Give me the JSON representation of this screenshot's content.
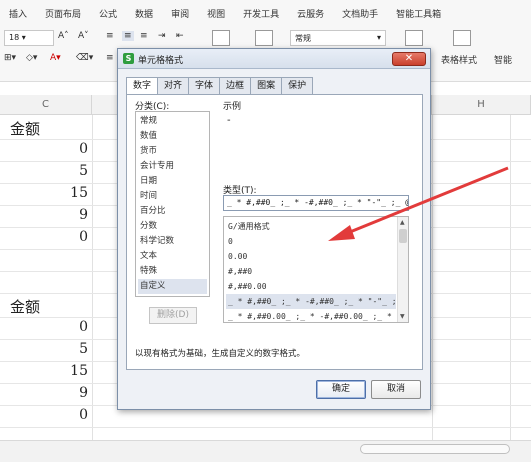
{
  "menubar": {
    "tabs": [
      "插入",
      "页面布局",
      "公式",
      "数据",
      "审阅",
      "视图",
      "开发工具",
      "云服务",
      "文档助手",
      "智能工具箱"
    ]
  },
  "ribbon": {
    "font_size": "18",
    "number_format": "常规",
    "table_style_label": "表格样式",
    "smart_label": "智能"
  },
  "sheet": {
    "col_c": "C",
    "col_h": "H",
    "header1": "金额",
    "header2": "金额",
    "values1": [
      "0",
      "5",
      "15",
      "9",
      "0"
    ],
    "values2": [
      "0",
      "5",
      "15",
      "9",
      "0"
    ]
  },
  "dialog": {
    "title": "单元格格式",
    "close_label": "✕",
    "tabs": [
      "数字",
      "对齐",
      "字体",
      "边框",
      "图案",
      "保护"
    ],
    "active_tab": "数字",
    "category_label": "分类(C):",
    "categories": [
      "常规",
      "数值",
      "货币",
      "会计专用",
      "日期",
      "时间",
      "百分比",
      "分数",
      "科学记数",
      "文本",
      "特殊",
      "自定义"
    ],
    "selected_category": "自定义",
    "sample_label": "示例",
    "sample_value": "-",
    "type_label": "类型(T):",
    "type_value": "_ * #,##0_ ;_ * -#,##0_ ;_ * \"-\"_ ;_ @_",
    "type_list": [
      "G/通用格式",
      "0",
      "0.00",
      "#,##0",
      "#,##0.00",
      "_ * #,##0_ ;_ * -#,##0_ ;_ * \"-\"_ ;_ @_",
      "_ * #,##0.00_ ;_ * -#,##0.00_ ;_ * \"-\"??_ ;_ @_"
    ],
    "selected_type_index": 5,
    "delete_button": "删除(D)",
    "description": "以现有格式为基础，生成自定义的数字格式。",
    "ok_button": "确定",
    "cancel_button": "取消"
  },
  "colors": {
    "accent_red": "#e23b3b",
    "selection": "#dde3ee"
  }
}
